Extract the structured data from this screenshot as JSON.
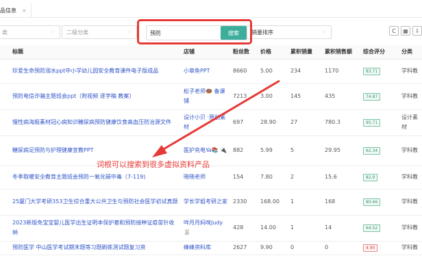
{
  "tab": {
    "label": "品信息",
    "close": "×"
  },
  "filters": {
    "first_category": "类",
    "second_category": "二级分类",
    "search_value": "预防",
    "search_button": "搜索",
    "sort": "销量排序"
  },
  "toolbar": {
    "refresh": "C",
    "columns": "▦",
    "export": "⇩"
  },
  "columns": [
    "标题",
    "店铺",
    "粉丝数",
    "价格",
    "累积销量",
    "累积销售额",
    "综合评分",
    "分类"
  ],
  "rows": [
    {
      "title": "珍爱生命预防溺水ppt中小学幼儿园安全教育课件电子版成品",
      "shop": "小章鱼PPT",
      "fans": "8660",
      "price": "5.00",
      "sales": "234",
      "revenue": "1170",
      "rating": "83.71",
      "category": "学科教"
    },
    {
      "title": "预防电信诈骗主题班会ppt（附视频 逐字稿 教案）",
      "shop": "松子老师🍩 备课铺",
      "fans": "7213",
      "price": "3.00",
      "sales": "145",
      "revenue": "435",
      "rating": "74.87",
      "category": "学科教"
    },
    {
      "title": "慢性病海报素材冠心病知识糖尿病预防健康饮食高血压防治源文件",
      "shop": "设计小贝 ·原创素材",
      "fans": "697",
      "price": "28.90",
      "sales": "27",
      "revenue": "780.3",
      "rating": "95.71",
      "category": "设计素材"
    },
    {
      "title": "糖尿病足预防与护理健康宣教PPT",
      "shop": "医护充电Ya📚 🔌",
      "fans": "882",
      "price": "5.99",
      "sales": "5",
      "revenue": "29.95",
      "rating": "62.34",
      "category": "学科教"
    },
    {
      "title": "冬季取暖安全教育主题班会预防一氧化碳中毒（7-119)",
      "shop": "晓晓老师",
      "fans": "154",
      "price": "7.80",
      "sales": "2",
      "revenue": "15.6",
      "rating": "82.9",
      "category": "学科教"
    },
    {
      "title": "25厦门大学考研353卫生综合重大公共卫生与预防社会医学初试真题",
      "shop": "学长学姐考研之家",
      "fans": "2330",
      "price": "168.00",
      "sales": "1",
      "revenue": "168",
      "rating": "80.66",
      "category": "学科教"
    },
    {
      "title": "2023新版免宝宝婴儿医学出生证明本保护套和预防接种证疫苗针收纳",
      "shop": "咩月月妈咪Judy 🐰",
      "fans": "428",
      "price": "14.00",
      "sales": "1",
      "revenue": "14",
      "rating": "64.52",
      "category": "学科教"
    },
    {
      "title": "预防医学 中山医学考试期末题等习题刷练测试题复习资",
      "shop": "蜂蜂资料库",
      "fans": "2627",
      "price": "9.90",
      "sales": "0",
      "revenue": "0",
      "rating": "4.90",
      "category": "学科教"
    }
  ],
  "annotation": "词根可以搜索到很多虚拟资料产品",
  "colors": {
    "accent": "#3dae9c",
    "highlight": "#e53935",
    "link": "#2f54c8"
  }
}
